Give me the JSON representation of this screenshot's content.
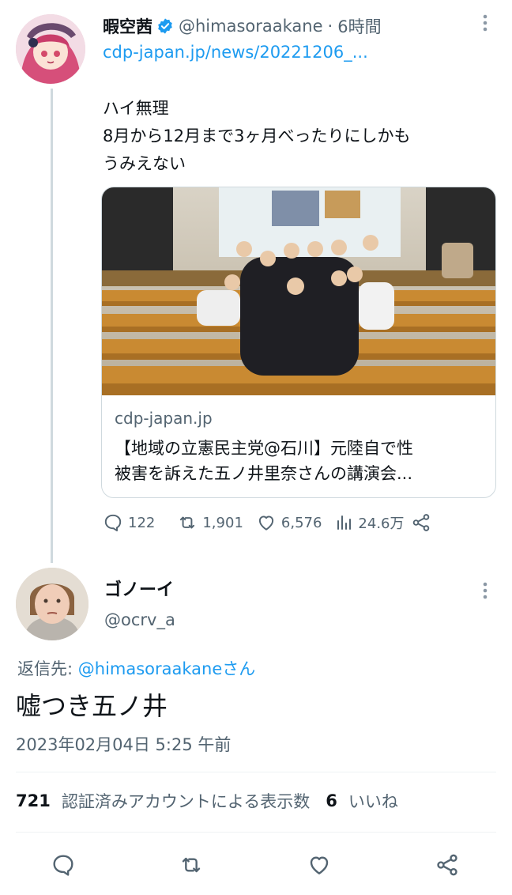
{
  "tweet1": {
    "display_name": "暇空茜",
    "handle": "@himasoraakane",
    "separator": "·",
    "time": "6時間",
    "link": "cdp-japan.jp/news/20221206_...",
    "text_lines": [
      "ハイ無理",
      "8月から12月まで3ヶ月べったりにしかも",
      "うみえない"
    ],
    "card": {
      "domain": "cdp-japan.jp",
      "title_lines": [
        "【地域の立憲民主党@石川】元陸自で性",
        "被害を訴えた五ノ井里奈さんの講演会..."
      ]
    },
    "actions": {
      "replies": "122",
      "retweets": "1,901",
      "likes": "6,576",
      "views": "24.6万"
    }
  },
  "tweet2": {
    "display_name": "ゴノーイ",
    "handle": "@ocrv_a",
    "replying_prefix": "返信先: ",
    "replying_mention": "@himasoraakane",
    "replying_suffix": "さん",
    "body": "嘘つき五ノ井",
    "timestamp": "2023年02月04日 5:25 午前",
    "stats": {
      "views_count": "721",
      "views_label": "認証済みアカウントによる表示数",
      "likes_count": "6",
      "likes_label": "いいね"
    }
  },
  "colors": {
    "accent": "#1d9bf0",
    "muted": "#536471",
    "border": "#cfd9de"
  }
}
